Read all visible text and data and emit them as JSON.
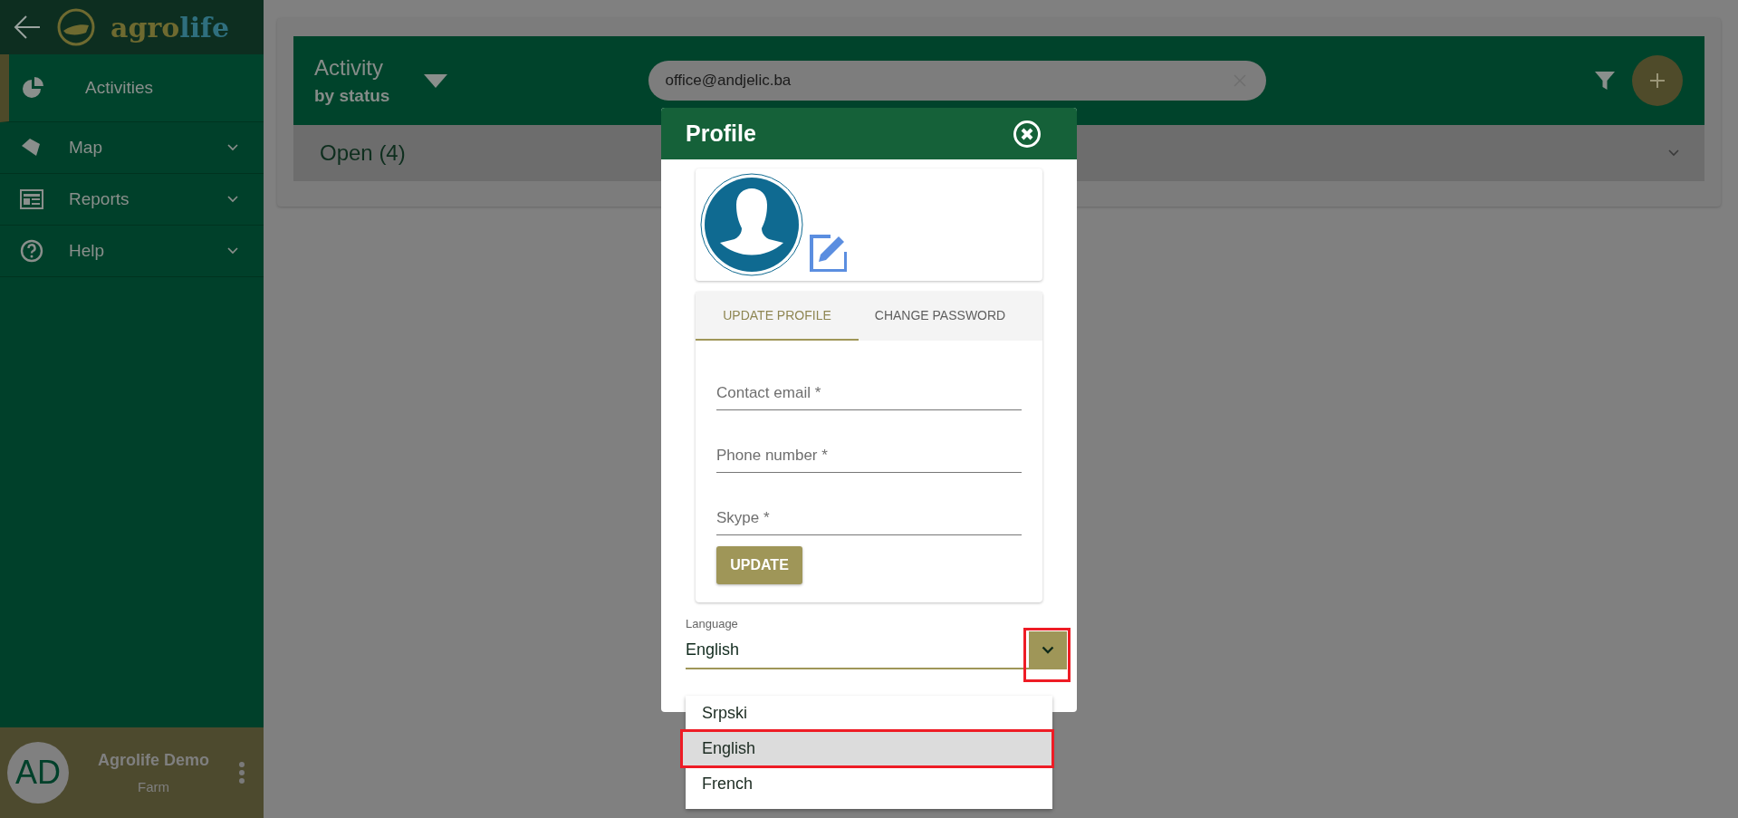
{
  "sidebar": {
    "logo": [
      "agro",
      "life"
    ],
    "items": [
      {
        "label": "Activities",
        "selected": true,
        "expandable": false
      },
      {
        "label": "Map",
        "selected": false,
        "expandable": true
      },
      {
        "label": "Reports",
        "selected": false,
        "expandable": true
      },
      {
        "label": "Help",
        "selected": false,
        "expandable": true
      }
    ],
    "user": {
      "initials": "AD",
      "name": "Agrolife Demo",
      "role": "Farm"
    }
  },
  "header": {
    "title": "Activity",
    "subtitle": "by status",
    "search": {
      "value": "office@andjelic.ba"
    }
  },
  "groups": [
    {
      "label": "Open (4)",
      "expanded": false
    }
  ],
  "profile": {
    "title": "Profile",
    "tabs": [
      {
        "label": "UPDATE PROFILE",
        "selected": true
      },
      {
        "label": "CHANGE PASSWORD",
        "selected": false
      }
    ],
    "fields": [
      {
        "placeholder": "Contact email *"
      },
      {
        "placeholder": "Phone number *"
      },
      {
        "placeholder": "Skype *"
      }
    ],
    "button": "UPDATE",
    "language": {
      "label": "Language",
      "value": "English",
      "open": true,
      "highlighted": true,
      "options": [
        {
          "label": "Srpski",
          "selected": false,
          "highlighted": false
        },
        {
          "label": "English",
          "selected": true,
          "highlighted": true
        },
        {
          "label": "French",
          "selected": false,
          "highlighted": false
        }
      ]
    }
  }
}
